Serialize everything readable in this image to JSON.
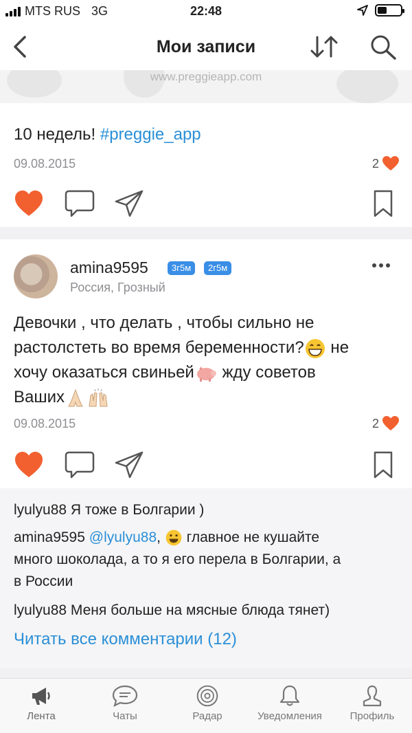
{
  "status_bar": {
    "carrier": "MTS RUS",
    "network": "3G",
    "time": "22:48"
  },
  "nav": {
    "title": "Мои записи"
  },
  "image_strip": {
    "url_text": "www.preggieapp.com"
  },
  "posts": [
    {
      "text": "10 недель! ",
      "hashtag": "#preggie_app",
      "date": "09.08.2015",
      "likes": "2"
    },
    {
      "author": "amina9595",
      "badges": [
        "3г5м",
        "2г5м"
      ],
      "location": "Россия, Грозный",
      "text_line1": "Девочки , что делать , чтобы сильно не",
      "text_line2_a": "растолстеть во время беременности?",
      "text_line2_b": " не",
      "text_line3_a": "хочу оказаться  свиньей",
      "text_line3_b": " жду советов",
      "text_line4": "Ваших",
      "date": "09.08.2015",
      "likes": "2"
    }
  ],
  "comments": [
    {
      "author": "lyulyu88",
      "text": " Я тоже в Болгарии )"
    },
    {
      "author": "amina9595",
      "mention": "@lyulyu88",
      "text_a": ", ",
      "text_b": " главное не кушайте",
      "text_line2": "много шоколада, а то я его перела в Болгарии, а",
      "text_line3": "в России"
    },
    {
      "author": "lyulyu88",
      "text": " Меня больше на мясные блюда тянет)"
    }
  ],
  "read_all_label": "Читать все комментарии (12)",
  "tabs": [
    {
      "label": "Лента",
      "icon": "megaphone-icon"
    },
    {
      "label": "Чаты",
      "icon": "chat-bubble-icon"
    },
    {
      "label": "Радар",
      "icon": "radar-icon"
    },
    {
      "label": "Уведомления",
      "icon": "bell-icon"
    },
    {
      "label": "Профиль",
      "icon": "profile-icon"
    }
  ],
  "colors": {
    "accent": "#2b8fd6",
    "heart": "#f26030",
    "badge": "#3a8ee6",
    "muted": "#8e8e93"
  }
}
